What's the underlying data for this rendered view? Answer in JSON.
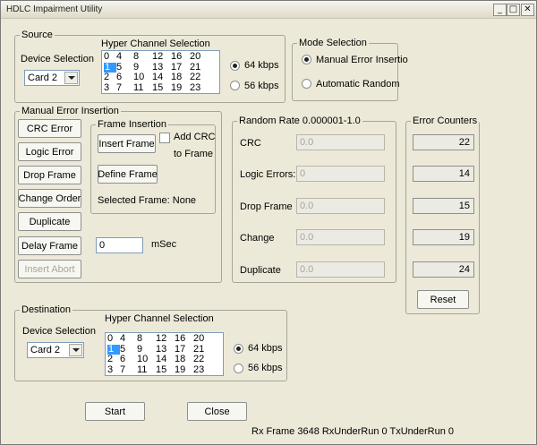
{
  "window": {
    "title": "HDLC Impairment Utility",
    "min_glyph": "_",
    "max_glyph": "□",
    "close_glyph": "✕"
  },
  "source": {
    "legend": "Source",
    "device_label": "Device Selection",
    "device_value": "Card 2",
    "hyper_label": "Hyper Channel Selection",
    "channels": [
      [
        "0",
        "4",
        "8",
        "12",
        "16",
        "20"
      ],
      [
        "1",
        "5",
        "9",
        "13",
        "17",
        "21"
      ],
      [
        "2",
        "6",
        "10",
        "14",
        "18",
        "22"
      ],
      [
        "3",
        "7",
        "11",
        "15",
        "19",
        "23"
      ]
    ],
    "selected_channel": "1",
    "rate_64": "64 kbps",
    "rate_56": "56 kbps",
    "selected_rate": "64 kbps"
  },
  "mode": {
    "legend": "Mode Selection",
    "manual": "Manual Error Insertio",
    "automatic": "Automatic Random",
    "selected": "manual"
  },
  "manual": {
    "legend": "Manual Error Insertion",
    "buttons": {
      "crc": "CRC Error",
      "logic": "Logic Error",
      "drop": "Drop Frame",
      "change": "Change Order",
      "duplicate": "Duplicate",
      "delay": "Delay Frame",
      "abort": "Insert Abort"
    },
    "frame": {
      "legend": "Frame Insertion",
      "insert": "Insert Frame",
      "add_crc_1": "Add CRC",
      "add_crc_2": "to Frame",
      "define": "Define Frame",
      "selected": "Selected Frame: None"
    },
    "delay_value": "0",
    "delay_unit": "mSec"
  },
  "random": {
    "legend": "Random Rate 0.000001-1.0",
    "rows": [
      {
        "label": "CRC",
        "value": "0.0"
      },
      {
        "label": "Logic Errors:",
        "value": "0"
      },
      {
        "label": "Drop Frame",
        "value": "0.0"
      },
      {
        "label": "Change",
        "value": "0.0"
      },
      {
        "label": "Duplicate",
        "value": "0.0"
      }
    ]
  },
  "counters": {
    "legend": "Error Counters",
    "values": [
      "22",
      "14",
      "15",
      "19",
      "24"
    ],
    "reset": "Reset"
  },
  "destination": {
    "legend": "Destination",
    "device_label": "Device Selection",
    "device_value": "Card 2",
    "hyper_label": "Hyper Channel Selection",
    "channels": [
      [
        "0",
        "4",
        "8",
        "12",
        "16",
        "20"
      ],
      [
        "1",
        "5",
        "9",
        "13",
        "17",
        "21"
      ],
      [
        "2",
        "6",
        "10",
        "14",
        "18",
        "22"
      ],
      [
        "3",
        "7",
        "11",
        "15",
        "19",
        "23"
      ]
    ],
    "selected_channel": "1",
    "rate_64": "64 kbps",
    "rate_56": "56 kbps",
    "selected_rate": "64 kbps"
  },
  "footer": {
    "start": "Start",
    "close": "Close",
    "status": "Rx Frame 3648 RxUnderRun 0 TxUnderRun 0"
  }
}
